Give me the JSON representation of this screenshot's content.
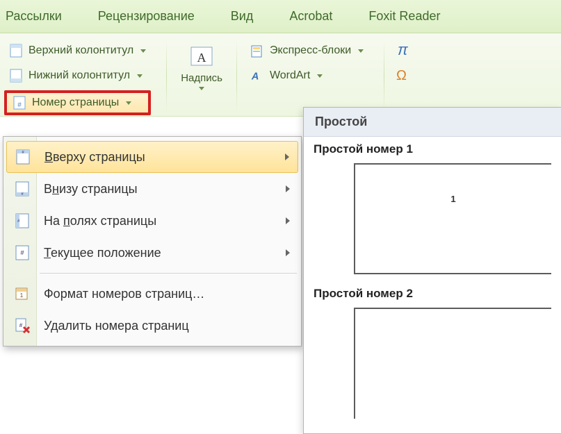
{
  "tabs": {
    "mailings": "Рассылки",
    "review": "Рецензирование",
    "view": "Вид",
    "acrobat": "Acrobat",
    "foxit": "Foxit Reader"
  },
  "ribbon": {
    "header": "Верхний колонтитул",
    "footer": "Нижний колонтитул",
    "page_number": "Номер страницы",
    "textbox": "Надпись",
    "quick_parts": "Экспресс-блоки",
    "wordart": "WordArt"
  },
  "dropdown": {
    "top_of_page": "Вверху страницы",
    "bottom_of_page": "Внизу страницы",
    "page_margins": "На полях страницы",
    "current_position": "Текущее положение",
    "format": "Формат номеров страниц…",
    "remove": "Удалить номера страниц"
  },
  "gallery": {
    "header": "Простой",
    "item1_title": "Простой номер 1",
    "item1_value": "1",
    "item2_title": "Простой номер 2"
  }
}
